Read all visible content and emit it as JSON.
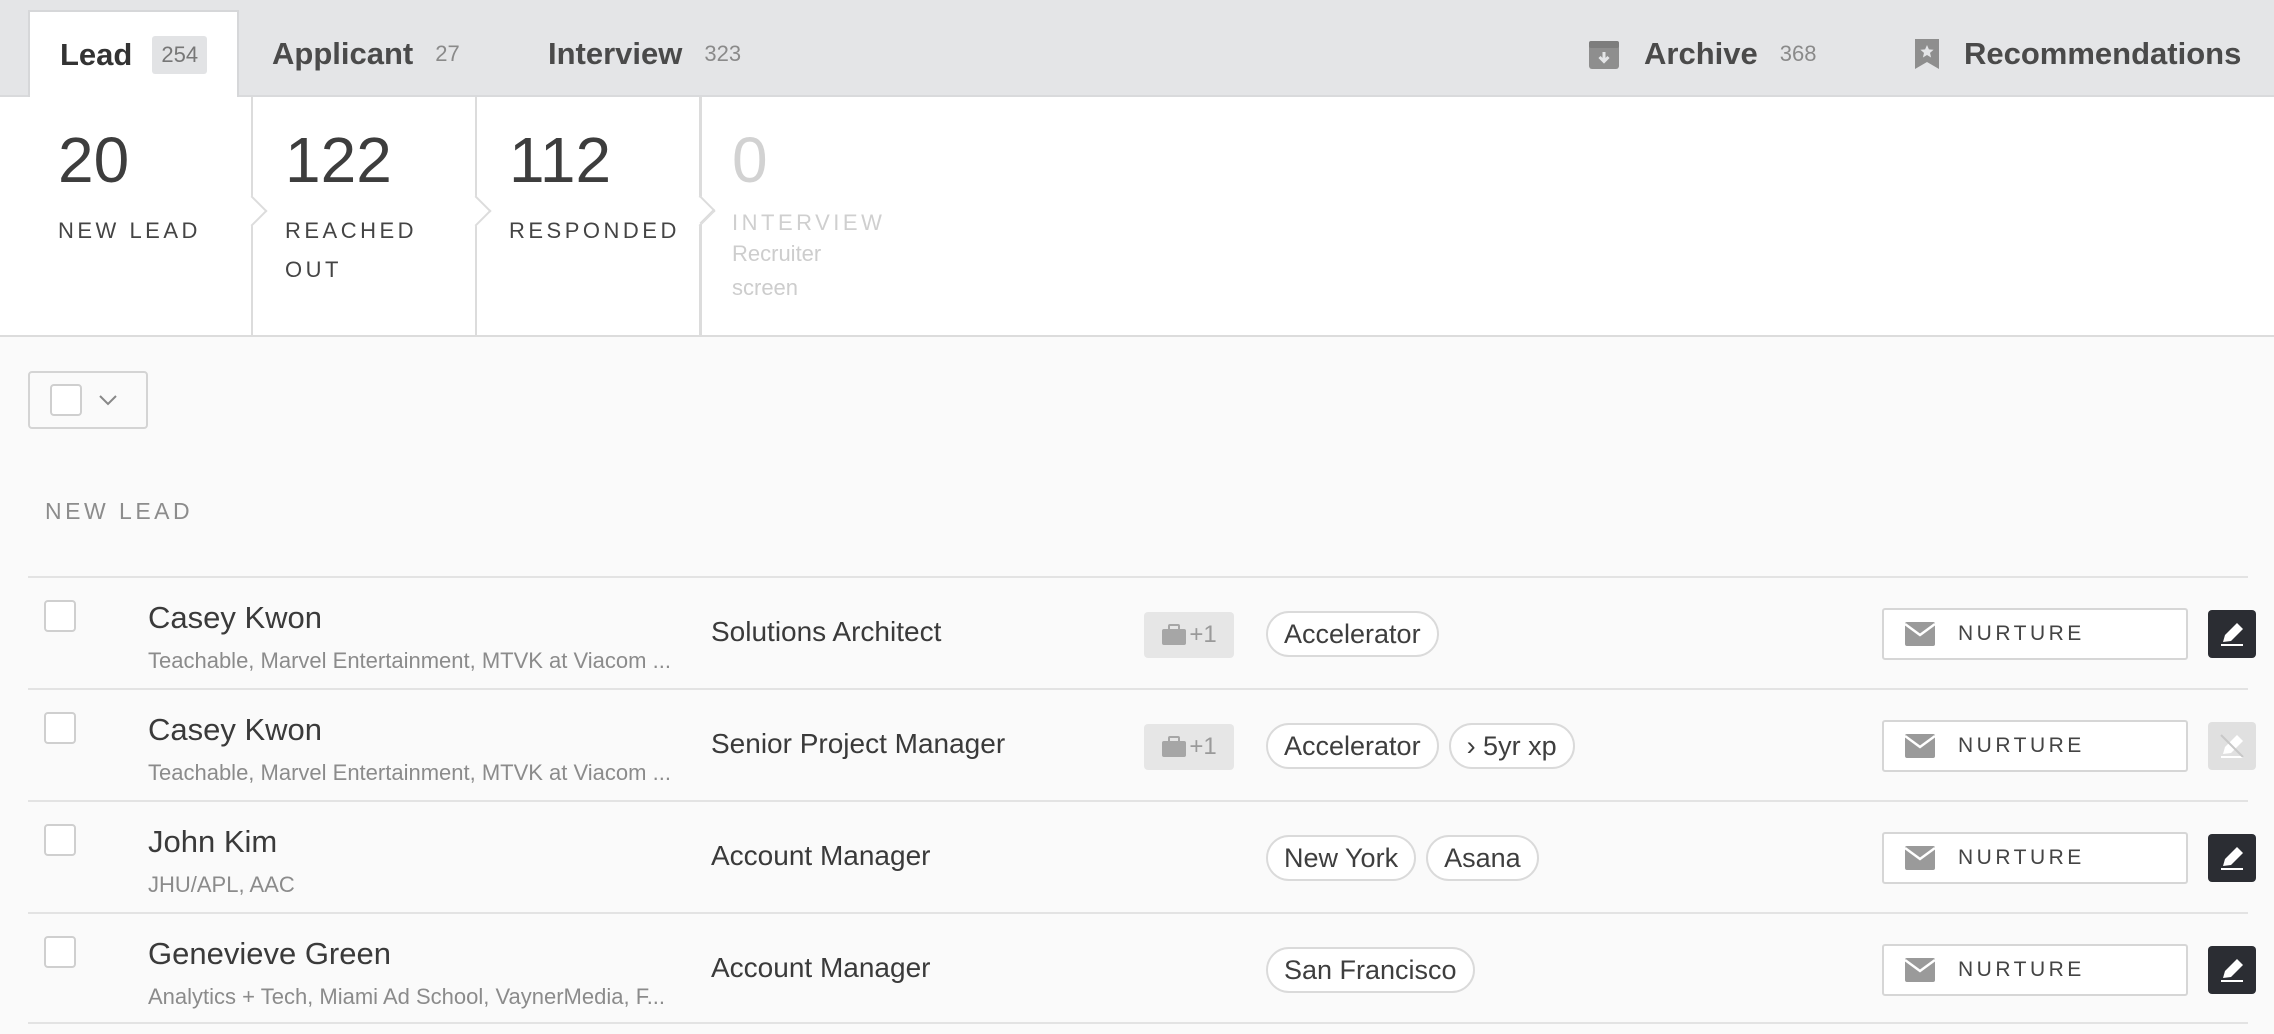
{
  "tabs": [
    {
      "label": "Lead",
      "count": "254"
    },
    {
      "label": "Applicant",
      "count": "27"
    },
    {
      "label": "Interview",
      "count": "323"
    }
  ],
  "right_tabs": {
    "archive": {
      "label": "Archive",
      "count": "368",
      "icon": "archive-box-icon"
    },
    "recommendations": {
      "label": "Recommendations",
      "icon": "star-bookmark-icon"
    }
  },
  "stages": [
    {
      "count": "20",
      "label": "NEW LEAD"
    },
    {
      "count": "122",
      "label": "REACHED OUT"
    },
    {
      "count": "112",
      "label": "RESPONDED"
    },
    {
      "count": "0",
      "label": "INTERVIEW",
      "sub": "Recruiter screen"
    }
  ],
  "section_title": "NEW LEAD",
  "rows": [
    {
      "name": "Casey Kwon",
      "companies": "Teachable, Marvel Entertainment, MTVK at Viacom ...",
      "title": "Solutions Architect",
      "jobs": "+1",
      "tags": [
        "Accelerator"
      ],
      "action": "NURTURE",
      "edit_enabled": true
    },
    {
      "name": "Casey Kwon",
      "companies": "Teachable, Marvel Entertainment, MTVK at Viacom ...",
      "title": "Senior Project Manager",
      "jobs": "+1",
      "tags": [
        "Accelerator",
        "› 5yr xp"
      ],
      "action": "NURTURE",
      "edit_enabled": false
    },
    {
      "name": "John Kim",
      "companies": "JHU/APL, AAC",
      "title": "Account Manager",
      "jobs": "",
      "tags": [
        "New York",
        "Asana"
      ],
      "action": "NURTURE",
      "edit_enabled": true
    },
    {
      "name": "Genevieve Green",
      "companies": "Analytics + Tech, Miami Ad School, VaynerMedia, F...",
      "title": "Account Manager",
      "jobs": "",
      "tags": [
        "San Francisco"
      ],
      "action": "NURTURE",
      "edit_enabled": true
    }
  ],
  "colors": {
    "tabbar_bg": "#e4e5e7",
    "edit_button": "#2b2d33",
    "muted_text": "#8b8b8b"
  }
}
